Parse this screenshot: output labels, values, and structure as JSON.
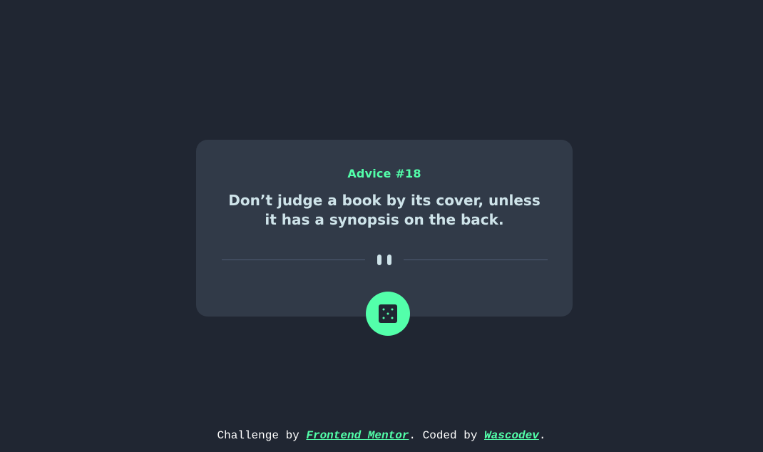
{
  "card": {
    "advice_label": "Advice #18",
    "advice_text": "Don’t judge a book by its cover, unless it has a synopsis on the back."
  },
  "icons": {
    "divider": "pause-icon",
    "button": "dice-icon"
  },
  "footer": {
    "prefix": "Challenge by ",
    "challenge_link": "Frontend Mentor",
    "middle": ". Coded by ",
    "author_link": "Wascodev",
    "suffix": "."
  },
  "colors": {
    "background": "#202632",
    "card": "#313a48",
    "accent": "#53ffaa",
    "text": "#cee3e9",
    "divider": "#4f5d74"
  }
}
